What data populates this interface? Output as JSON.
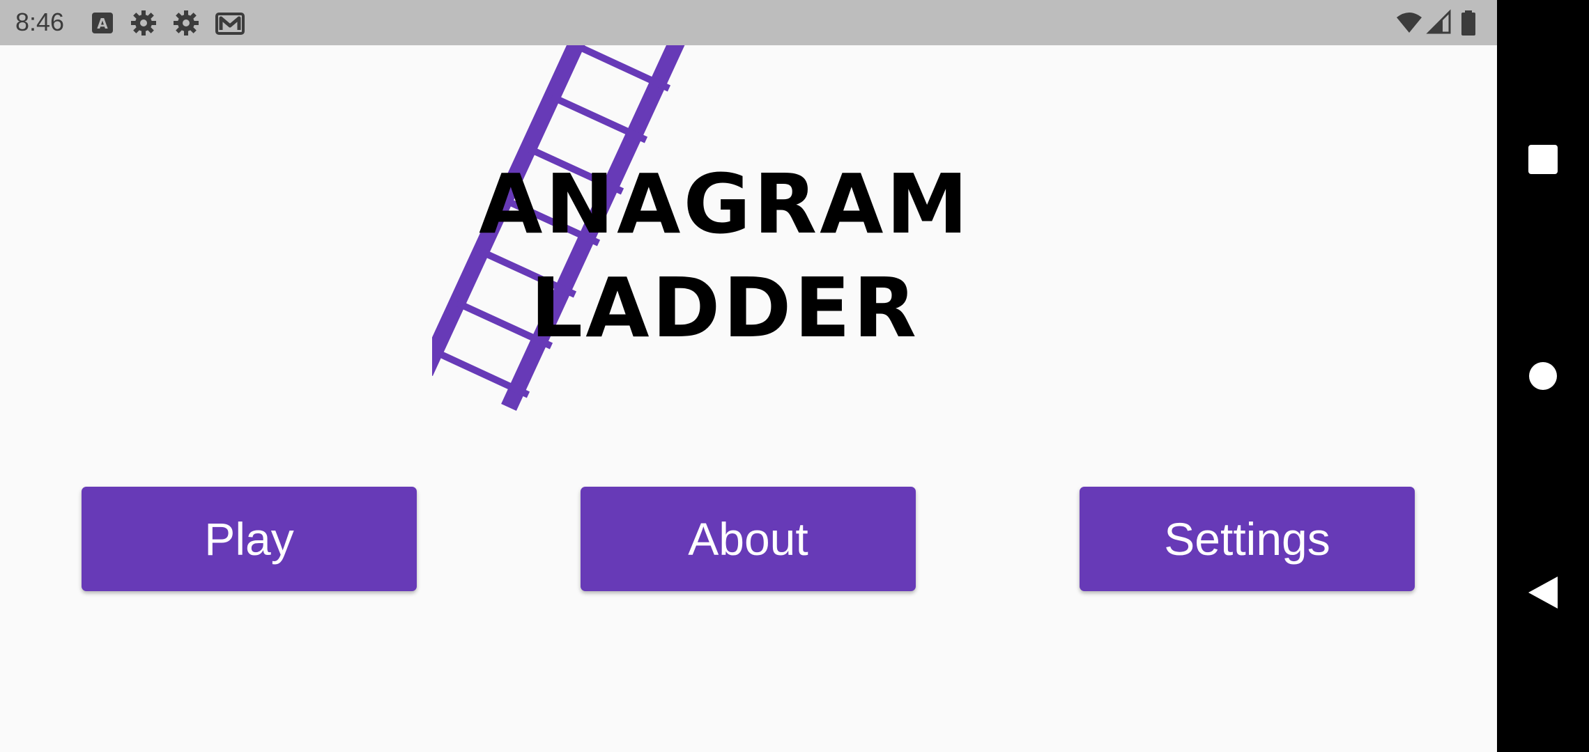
{
  "status_bar": {
    "time": "8:46",
    "icons": [
      "keyboard-a-icon",
      "gear-icon",
      "gear-icon",
      "gmail-icon",
      "wifi-icon",
      "cell-signal-icon",
      "battery-icon"
    ]
  },
  "title": {
    "line1": "ANAGRAM",
    "line2": "LADDER"
  },
  "logo": {
    "icon": "ladder-icon",
    "color": "#673ab7"
  },
  "buttons": {
    "play": "Play",
    "about": "About",
    "settings": "Settings"
  },
  "nav": {
    "recents": "square-icon",
    "home": "circle-icon",
    "back": "triangle-back-icon"
  },
  "colors": {
    "accent": "#673ab7",
    "background": "#fafafa",
    "status_bar": "#bdbdbd",
    "nav_bar": "#000000"
  }
}
